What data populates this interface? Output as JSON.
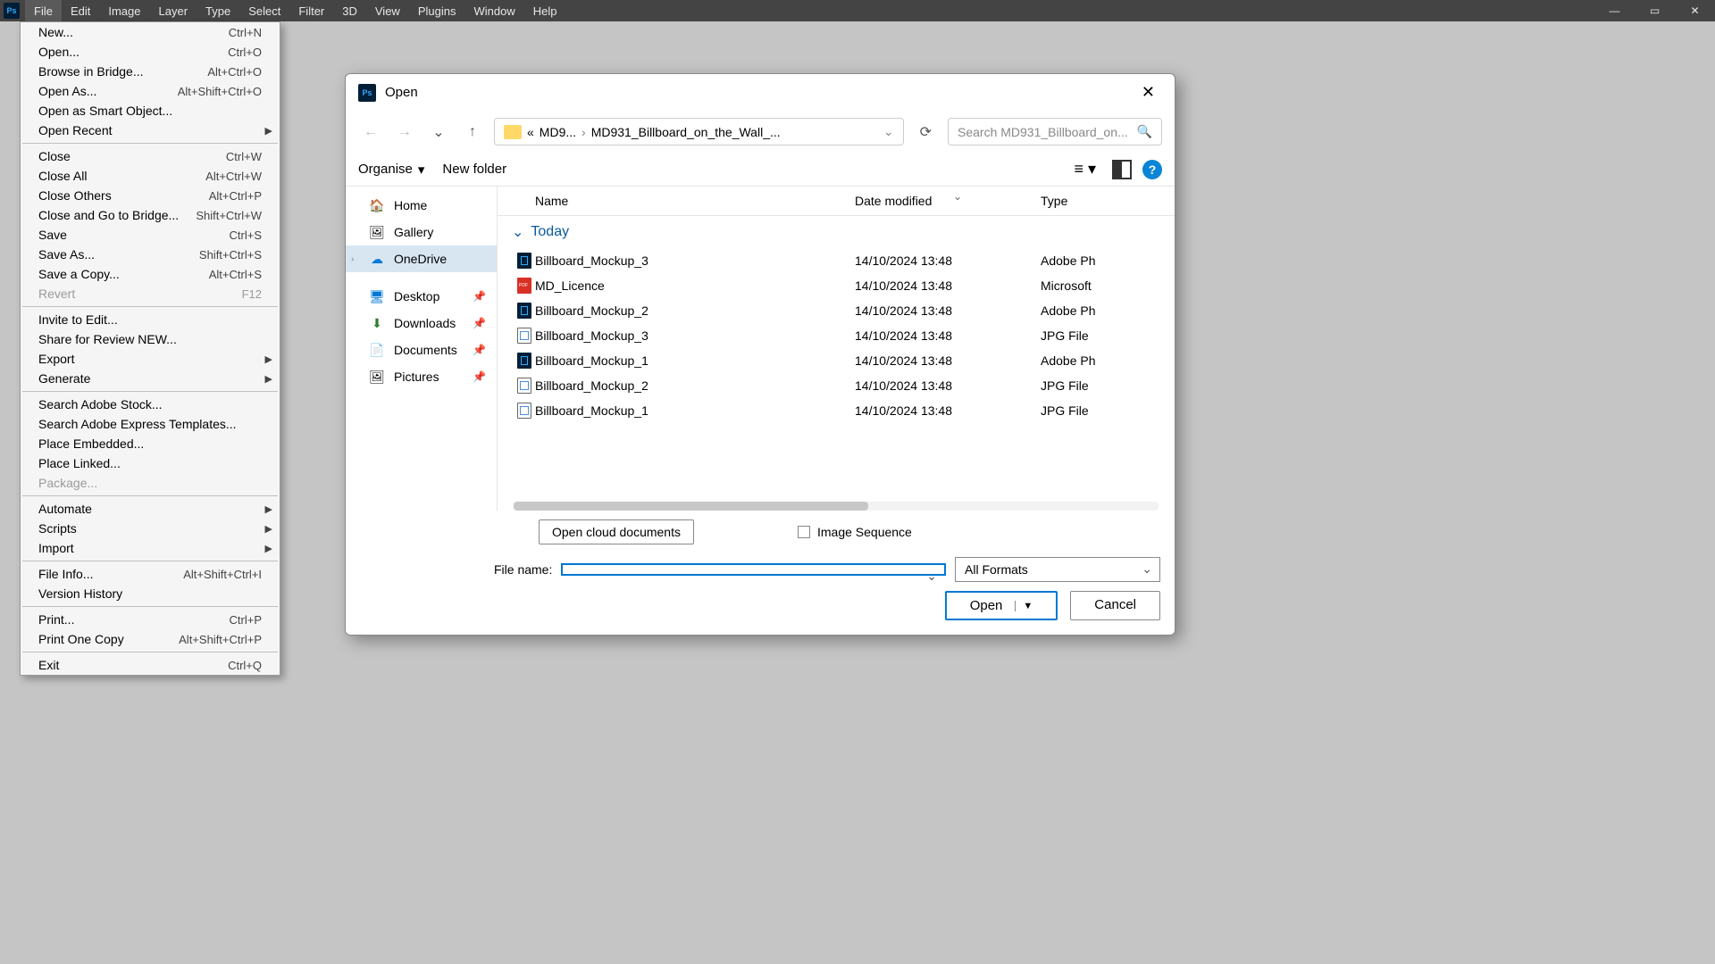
{
  "menubar": {
    "items": [
      "File",
      "Edit",
      "Image",
      "Layer",
      "Type",
      "Select",
      "Filter",
      "3D",
      "View",
      "Plugins",
      "Window",
      "Help"
    ]
  },
  "dropdown": [
    {
      "t": "item",
      "label": "New...",
      "shortcut": "Ctrl+N"
    },
    {
      "t": "item",
      "label": "Open...",
      "shortcut": "Ctrl+O"
    },
    {
      "t": "item",
      "label": "Browse in Bridge...",
      "shortcut": "Alt+Ctrl+O"
    },
    {
      "t": "item",
      "label": "Open As...",
      "shortcut": "Alt+Shift+Ctrl+O"
    },
    {
      "t": "item",
      "label": "Open as Smart Object..."
    },
    {
      "t": "item",
      "label": "Open Recent",
      "sub": true
    },
    {
      "t": "sep"
    },
    {
      "t": "item",
      "label": "Close",
      "shortcut": "Ctrl+W"
    },
    {
      "t": "item",
      "label": "Close All",
      "shortcut": "Alt+Ctrl+W"
    },
    {
      "t": "item",
      "label": "Close Others",
      "shortcut": "Alt+Ctrl+P"
    },
    {
      "t": "item",
      "label": "Close and Go to Bridge...",
      "shortcut": "Shift+Ctrl+W"
    },
    {
      "t": "item",
      "label": "Save",
      "shortcut": "Ctrl+S"
    },
    {
      "t": "item",
      "label": "Save As...",
      "shortcut": "Shift+Ctrl+S"
    },
    {
      "t": "item",
      "label": "Save a Copy...",
      "shortcut": "Alt+Ctrl+S"
    },
    {
      "t": "item",
      "label": "Revert",
      "shortcut": "F12",
      "disabled": true
    },
    {
      "t": "sep"
    },
    {
      "t": "item",
      "label": "Invite to Edit..."
    },
    {
      "t": "item",
      "label": "Share for Review NEW..."
    },
    {
      "t": "item",
      "label": "Export",
      "sub": true
    },
    {
      "t": "item",
      "label": "Generate",
      "sub": true
    },
    {
      "t": "sep"
    },
    {
      "t": "item",
      "label": "Search Adobe Stock..."
    },
    {
      "t": "item",
      "label": "Search Adobe Express Templates..."
    },
    {
      "t": "item",
      "label": "Place Embedded..."
    },
    {
      "t": "item",
      "label": "Place Linked..."
    },
    {
      "t": "item",
      "label": "Package...",
      "disabled": true
    },
    {
      "t": "sep"
    },
    {
      "t": "item",
      "label": "Automate",
      "sub": true
    },
    {
      "t": "item",
      "label": "Scripts",
      "sub": true
    },
    {
      "t": "item",
      "label": "Import",
      "sub": true
    },
    {
      "t": "sep"
    },
    {
      "t": "item",
      "label": "File Info...",
      "shortcut": "Alt+Shift+Ctrl+I"
    },
    {
      "t": "item",
      "label": "Version History"
    },
    {
      "t": "sep"
    },
    {
      "t": "item",
      "label": "Print...",
      "shortcut": "Ctrl+P"
    },
    {
      "t": "item",
      "label": "Print One Copy",
      "shortcut": "Alt+Shift+Ctrl+P"
    },
    {
      "t": "sep"
    },
    {
      "t": "item",
      "label": "Exit",
      "shortcut": "Ctrl+Q"
    }
  ],
  "dialog": {
    "title": "Open",
    "crumb_prefix": "«",
    "crumb1": "MD9...",
    "crumb2": "MD931_Billboard_on_the_Wall_...",
    "search_placeholder": "Search MD931_Billboard_on...",
    "organise": "Organise",
    "new_folder": "New folder",
    "headers": {
      "name": "Name",
      "date": "Date modified",
      "type": "Type"
    },
    "group": "Today",
    "sidebar": {
      "home": "Home",
      "gallery": "Gallery",
      "onedrive": "OneDrive",
      "desktop": "Desktop",
      "downloads": "Downloads",
      "documents": "Documents",
      "pictures": "Pictures"
    },
    "files": [
      {
        "name": "Billboard_Mockup_3",
        "date": "14/10/2024 13:48",
        "type": "Adobe Ph",
        "ic": "psd"
      },
      {
        "name": "MD_Licence",
        "date": "14/10/2024 13:48",
        "type": "Microsoft",
        "ic": "pdf"
      },
      {
        "name": "Billboard_Mockup_2",
        "date": "14/10/2024 13:48",
        "type": "Adobe Ph",
        "ic": "psd"
      },
      {
        "name": "Billboard_Mockup_3",
        "date": "14/10/2024 13:48",
        "type": "JPG File",
        "ic": "jpg"
      },
      {
        "name": "Billboard_Mockup_1",
        "date": "14/10/2024 13:48",
        "type": "Adobe Ph",
        "ic": "psd"
      },
      {
        "name": "Billboard_Mockup_2",
        "date": "14/10/2024 13:48",
        "type": "JPG File",
        "ic": "jpg"
      },
      {
        "name": "Billboard_Mockup_1",
        "date": "14/10/2024 13:48",
        "type": "JPG File",
        "ic": "jpg"
      }
    ],
    "cloud_btn": "Open cloud documents",
    "img_seq": "Image Sequence",
    "filename_label": "File name:",
    "filename_value": "",
    "formats": "All Formats",
    "open_btn": "Open",
    "cancel_btn": "Cancel"
  }
}
